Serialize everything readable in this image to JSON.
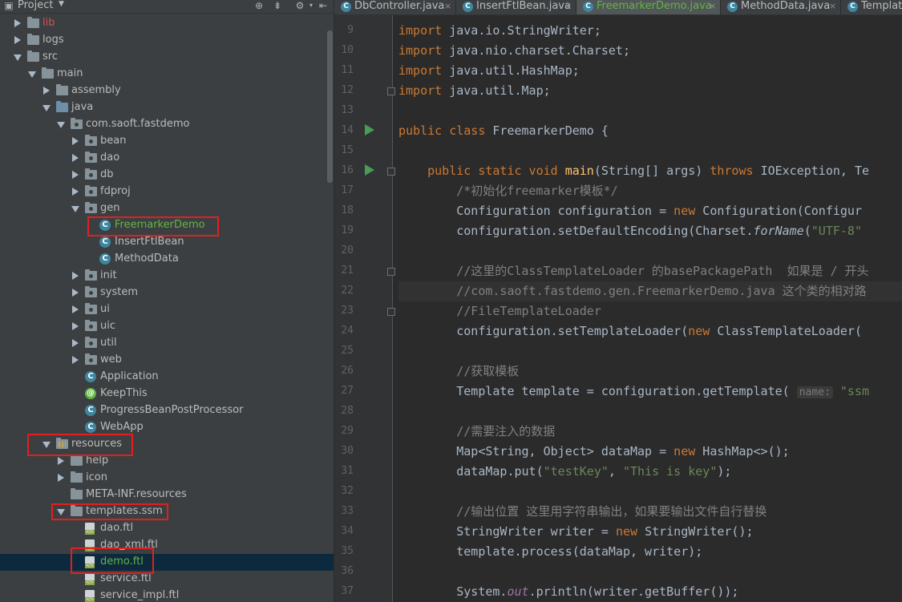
{
  "project": {
    "title": "Project",
    "dropdown_icon": "caret-down-icon",
    "header_icons": [
      "target-icon",
      "collapse-icon",
      "gear-icon",
      "hide-icon"
    ],
    "tree": [
      {
        "label": "lib",
        "indent": 0,
        "type": "folder",
        "expanded": false,
        "style": "red"
      },
      {
        "label": "logs",
        "indent": 0,
        "type": "folder",
        "expanded": false
      },
      {
        "label": "src",
        "indent": 0,
        "type": "folder",
        "expanded": true
      },
      {
        "label": "main",
        "indent": 1,
        "type": "folder",
        "expanded": true
      },
      {
        "label": "assembly",
        "indent": 2,
        "type": "folder",
        "expanded": false
      },
      {
        "label": "java",
        "indent": 2,
        "type": "folder-blue",
        "expanded": true
      },
      {
        "label": "com.saoft.fastdemo",
        "indent": 3,
        "type": "package",
        "expanded": true
      },
      {
        "label": "bean",
        "indent": 4,
        "type": "package",
        "expanded": false
      },
      {
        "label": "dao",
        "indent": 4,
        "type": "package",
        "expanded": false
      },
      {
        "label": "db",
        "indent": 4,
        "type": "package",
        "expanded": false
      },
      {
        "label": "fdproj",
        "indent": 4,
        "type": "package",
        "expanded": false
      },
      {
        "label": "gen",
        "indent": 4,
        "type": "package",
        "expanded": true
      },
      {
        "label": "FreemarkerDemo",
        "indent": 5,
        "type": "class",
        "style": "green"
      },
      {
        "label": "InsertFtlBean",
        "indent": 5,
        "type": "class"
      },
      {
        "label": "MethodData",
        "indent": 5,
        "type": "class"
      },
      {
        "label": "init",
        "indent": 4,
        "type": "package",
        "expanded": false
      },
      {
        "label": "system",
        "indent": 4,
        "type": "package",
        "expanded": false
      },
      {
        "label": "ui",
        "indent": 4,
        "type": "package",
        "expanded": false
      },
      {
        "label": "uic",
        "indent": 4,
        "type": "package",
        "expanded": false
      },
      {
        "label": "util",
        "indent": 4,
        "type": "package",
        "expanded": false
      },
      {
        "label": "web",
        "indent": 4,
        "type": "package",
        "expanded": false
      },
      {
        "label": "Application",
        "indent": 4,
        "type": "class"
      },
      {
        "label": "KeepThis",
        "indent": 4,
        "type": "annotation"
      },
      {
        "label": "ProgressBeanPostProcessor",
        "indent": 4,
        "type": "class"
      },
      {
        "label": "WebApp",
        "indent": 4,
        "type": "class"
      },
      {
        "label": "resources",
        "indent": 2,
        "type": "resources",
        "expanded": true
      },
      {
        "label": "help",
        "indent": 3,
        "type": "folder",
        "expanded": false
      },
      {
        "label": "icon",
        "indent": 3,
        "type": "folder",
        "expanded": false
      },
      {
        "label": "META-INF.resources",
        "indent": 3,
        "type": "folder"
      },
      {
        "label": "templates.ssm",
        "indent": 3,
        "type": "folder",
        "expanded": true
      },
      {
        "label": "dao.ftl",
        "indent": 4,
        "type": "ftl"
      },
      {
        "label": "dao_xml.ftl",
        "indent": 4,
        "type": "ftl"
      },
      {
        "label": "demo.ftl",
        "indent": 4,
        "type": "ftl",
        "style": "green",
        "selected": true
      },
      {
        "label": "service.ftl",
        "indent": 4,
        "type": "ftl"
      },
      {
        "label": "service_impl.ftl",
        "indent": 4,
        "type": "ftl"
      }
    ],
    "highlighted": [
      "FreemarkerDemo",
      "resources",
      "templates.ssm",
      "demo.ftl"
    ]
  },
  "editor": {
    "tabs": [
      {
        "label": "DbController.java",
        "active": false
      },
      {
        "label": "InsertFtlBean.java",
        "active": false
      },
      {
        "label": "FreemarkerDemo.java",
        "active": true
      },
      {
        "label": "MethodData.java",
        "active": false
      },
      {
        "label": "Template",
        "active": false
      }
    ],
    "line_numbers": [
      "9",
      "10",
      "11",
      "12",
      "13",
      "14",
      "15",
      "16",
      "17",
      "18",
      "19",
      "20",
      "21",
      "22",
      "23",
      "24",
      "25",
      "26",
      "27",
      "28",
      "29",
      "30",
      "31",
      "32",
      "33",
      "34",
      "35",
      "36",
      "37"
    ],
    "run_markers": [
      "14",
      "16"
    ],
    "lines": [
      [
        [
          "kw",
          "import "
        ],
        [
          "p",
          "java.io.StringWriter;"
        ]
      ],
      [
        [
          "kw",
          "import "
        ],
        [
          "p",
          "java.nio.charset.Charset;"
        ]
      ],
      [
        [
          "kw",
          "import "
        ],
        [
          "p",
          "java.util.HashMap;"
        ]
      ],
      [
        [
          "kw",
          "import "
        ],
        [
          "p",
          "java.util.Map;"
        ]
      ],
      [],
      [
        [
          "kw",
          "public class "
        ],
        [
          "p",
          "FreemarkerDemo {"
        ]
      ],
      [],
      [
        [
          "p",
          "    "
        ],
        [
          "kw",
          "public static void "
        ],
        [
          "fn",
          "main"
        ],
        [
          "p",
          "(String[] args) "
        ],
        [
          "kw",
          "throws "
        ],
        [
          "p",
          "IOException, Te"
        ]
      ],
      [
        [
          "p",
          "        "
        ],
        [
          "cmt",
          "/*初始化freemarker模板*/"
        ]
      ],
      [
        [
          "p",
          "        Configuration configuration = "
        ],
        [
          "kw",
          "new "
        ],
        [
          "p",
          "Configuration(Configur"
        ]
      ],
      [
        [
          "p",
          "        configuration.setDefaultEncoding(Charset."
        ],
        [
          "it",
          "forName"
        ],
        [
          "p",
          "("
        ],
        [
          "str",
          "\"UTF-8\""
        ]
      ],
      [],
      [
        [
          "p",
          "        "
        ],
        [
          "cmt",
          "//这里的ClassTemplateLoader 的basePackagePath  如果是 / 开头"
        ]
      ],
      [
        [
          "p",
          "        "
        ],
        [
          "cmt",
          "//com.saoft.fastdemo.gen.FreemarkerDemo.java 这个类的相对路"
        ]
      ],
      [
        [
          "p",
          "        "
        ],
        [
          "cmt",
          "//FileTemplateLoader"
        ]
      ],
      [
        [
          "p",
          "        configuration.setTemplateLoader("
        ],
        [
          "kw",
          "new "
        ],
        [
          "p",
          "ClassTemplateLoader("
        ]
      ],
      [],
      [
        [
          "p",
          "        "
        ],
        [
          "cmt",
          "//获取模板"
        ]
      ],
      [
        [
          "p",
          "        Template template = configuration.getTemplate( "
        ],
        [
          "hint",
          "name:"
        ],
        [
          "str",
          " \"ssm"
        ]
      ],
      [],
      [
        [
          "p",
          "        "
        ],
        [
          "cmt",
          "//需要注入的数据"
        ]
      ],
      [
        [
          "p",
          "        Map<String, Object> dataMap = "
        ],
        [
          "kw",
          "new "
        ],
        [
          "p",
          "HashMap<>();"
        ]
      ],
      [
        [
          "p",
          "        dataMap.put("
        ],
        [
          "str",
          "\"testKey\""
        ],
        [
          "p",
          ", "
        ],
        [
          "str",
          "\"This is key\""
        ],
        [
          "p",
          ");"
        ]
      ],
      [],
      [
        [
          "p",
          "        "
        ],
        [
          "cmt",
          "//输出位置 这里用字符串输出，如果要输出文件自行替换"
        ]
      ],
      [
        [
          "p",
          "        StringWriter writer = "
        ],
        [
          "kw",
          "new "
        ],
        [
          "p",
          "StringWriter();"
        ]
      ],
      [
        [
          "p",
          "        template.process(dataMap, writer);"
        ]
      ],
      [],
      [
        [
          "p",
          "        System."
        ],
        [
          "itp",
          "out"
        ],
        [
          "p",
          ".println(writer.getBuffer());"
        ]
      ]
    ],
    "current_line": "22"
  }
}
